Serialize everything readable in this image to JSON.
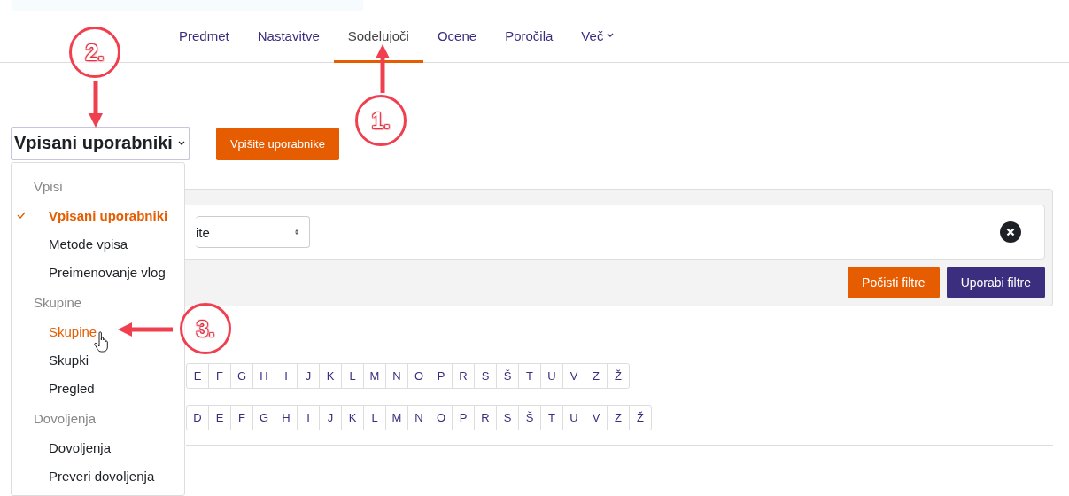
{
  "tabs": [
    {
      "label": "Predmet",
      "selected": false,
      "kind": "link"
    },
    {
      "label": "Nastavitve",
      "selected": false,
      "kind": "link"
    },
    {
      "label": "Sodelujoči",
      "selected": true,
      "kind": "link"
    },
    {
      "label": "Ocene",
      "selected": false,
      "kind": "link"
    },
    {
      "label": "Poročila",
      "selected": false,
      "kind": "link"
    },
    {
      "label": "Več",
      "selected": false,
      "kind": "dropdown"
    }
  ],
  "page_select": {
    "label": "Vpisani uporabniki",
    "expanded": true
  },
  "enrol_button": "Vpišite uporabnike",
  "menu": {
    "groups": [
      {
        "heading": "Vpisi",
        "items": [
          {
            "label": "Vpisani uporabniki",
            "selected": true,
            "hovered": false
          },
          {
            "label": "Metode vpisa",
            "selected": false,
            "hovered": false
          },
          {
            "label": "Preimenovanje vlog",
            "selected": false,
            "hovered": false
          }
        ]
      },
      {
        "heading": "Skupine",
        "items": [
          {
            "label": "Skupine",
            "selected": false,
            "hovered": true
          },
          {
            "label": "Skupki",
            "selected": false,
            "hovered": false
          },
          {
            "label": "Pregled",
            "selected": false,
            "hovered": false
          }
        ]
      },
      {
        "heading": "Dovoljenja",
        "items": [
          {
            "label": "Dovoljenja",
            "selected": false,
            "hovered": false
          },
          {
            "label": "Preveri dovoljenja",
            "selected": false,
            "hovered": false
          }
        ]
      }
    ]
  },
  "filter": {
    "select_value": "ite",
    "buttons": [
      {
        "label": "Počisti filtre",
        "kind": "secondary"
      },
      {
        "label": "Uporabi filtre",
        "kind": "primary"
      }
    ]
  },
  "initials_rows": [
    {
      "letters": [
        "E",
        "F",
        "G",
        "H",
        "I",
        "J",
        "K",
        "L",
        "M",
        "N",
        "O",
        "P",
        "R",
        "S",
        "Š",
        "T",
        "U",
        "V",
        "Z",
        "Ž"
      ]
    },
    {
      "letters": [
        "D",
        "E",
        "F",
        "G",
        "H",
        "I",
        "J",
        "K",
        "L",
        "M",
        "N",
        "O",
        "P",
        "R",
        "S",
        "Š",
        "T",
        "U",
        "V",
        "Z",
        "Ž"
      ]
    }
  ],
  "annotations": [
    {
      "label": "1.",
      "kind": "up"
    },
    {
      "label": "2.",
      "kind": "down"
    },
    {
      "label": "3.",
      "kind": "left"
    }
  ]
}
